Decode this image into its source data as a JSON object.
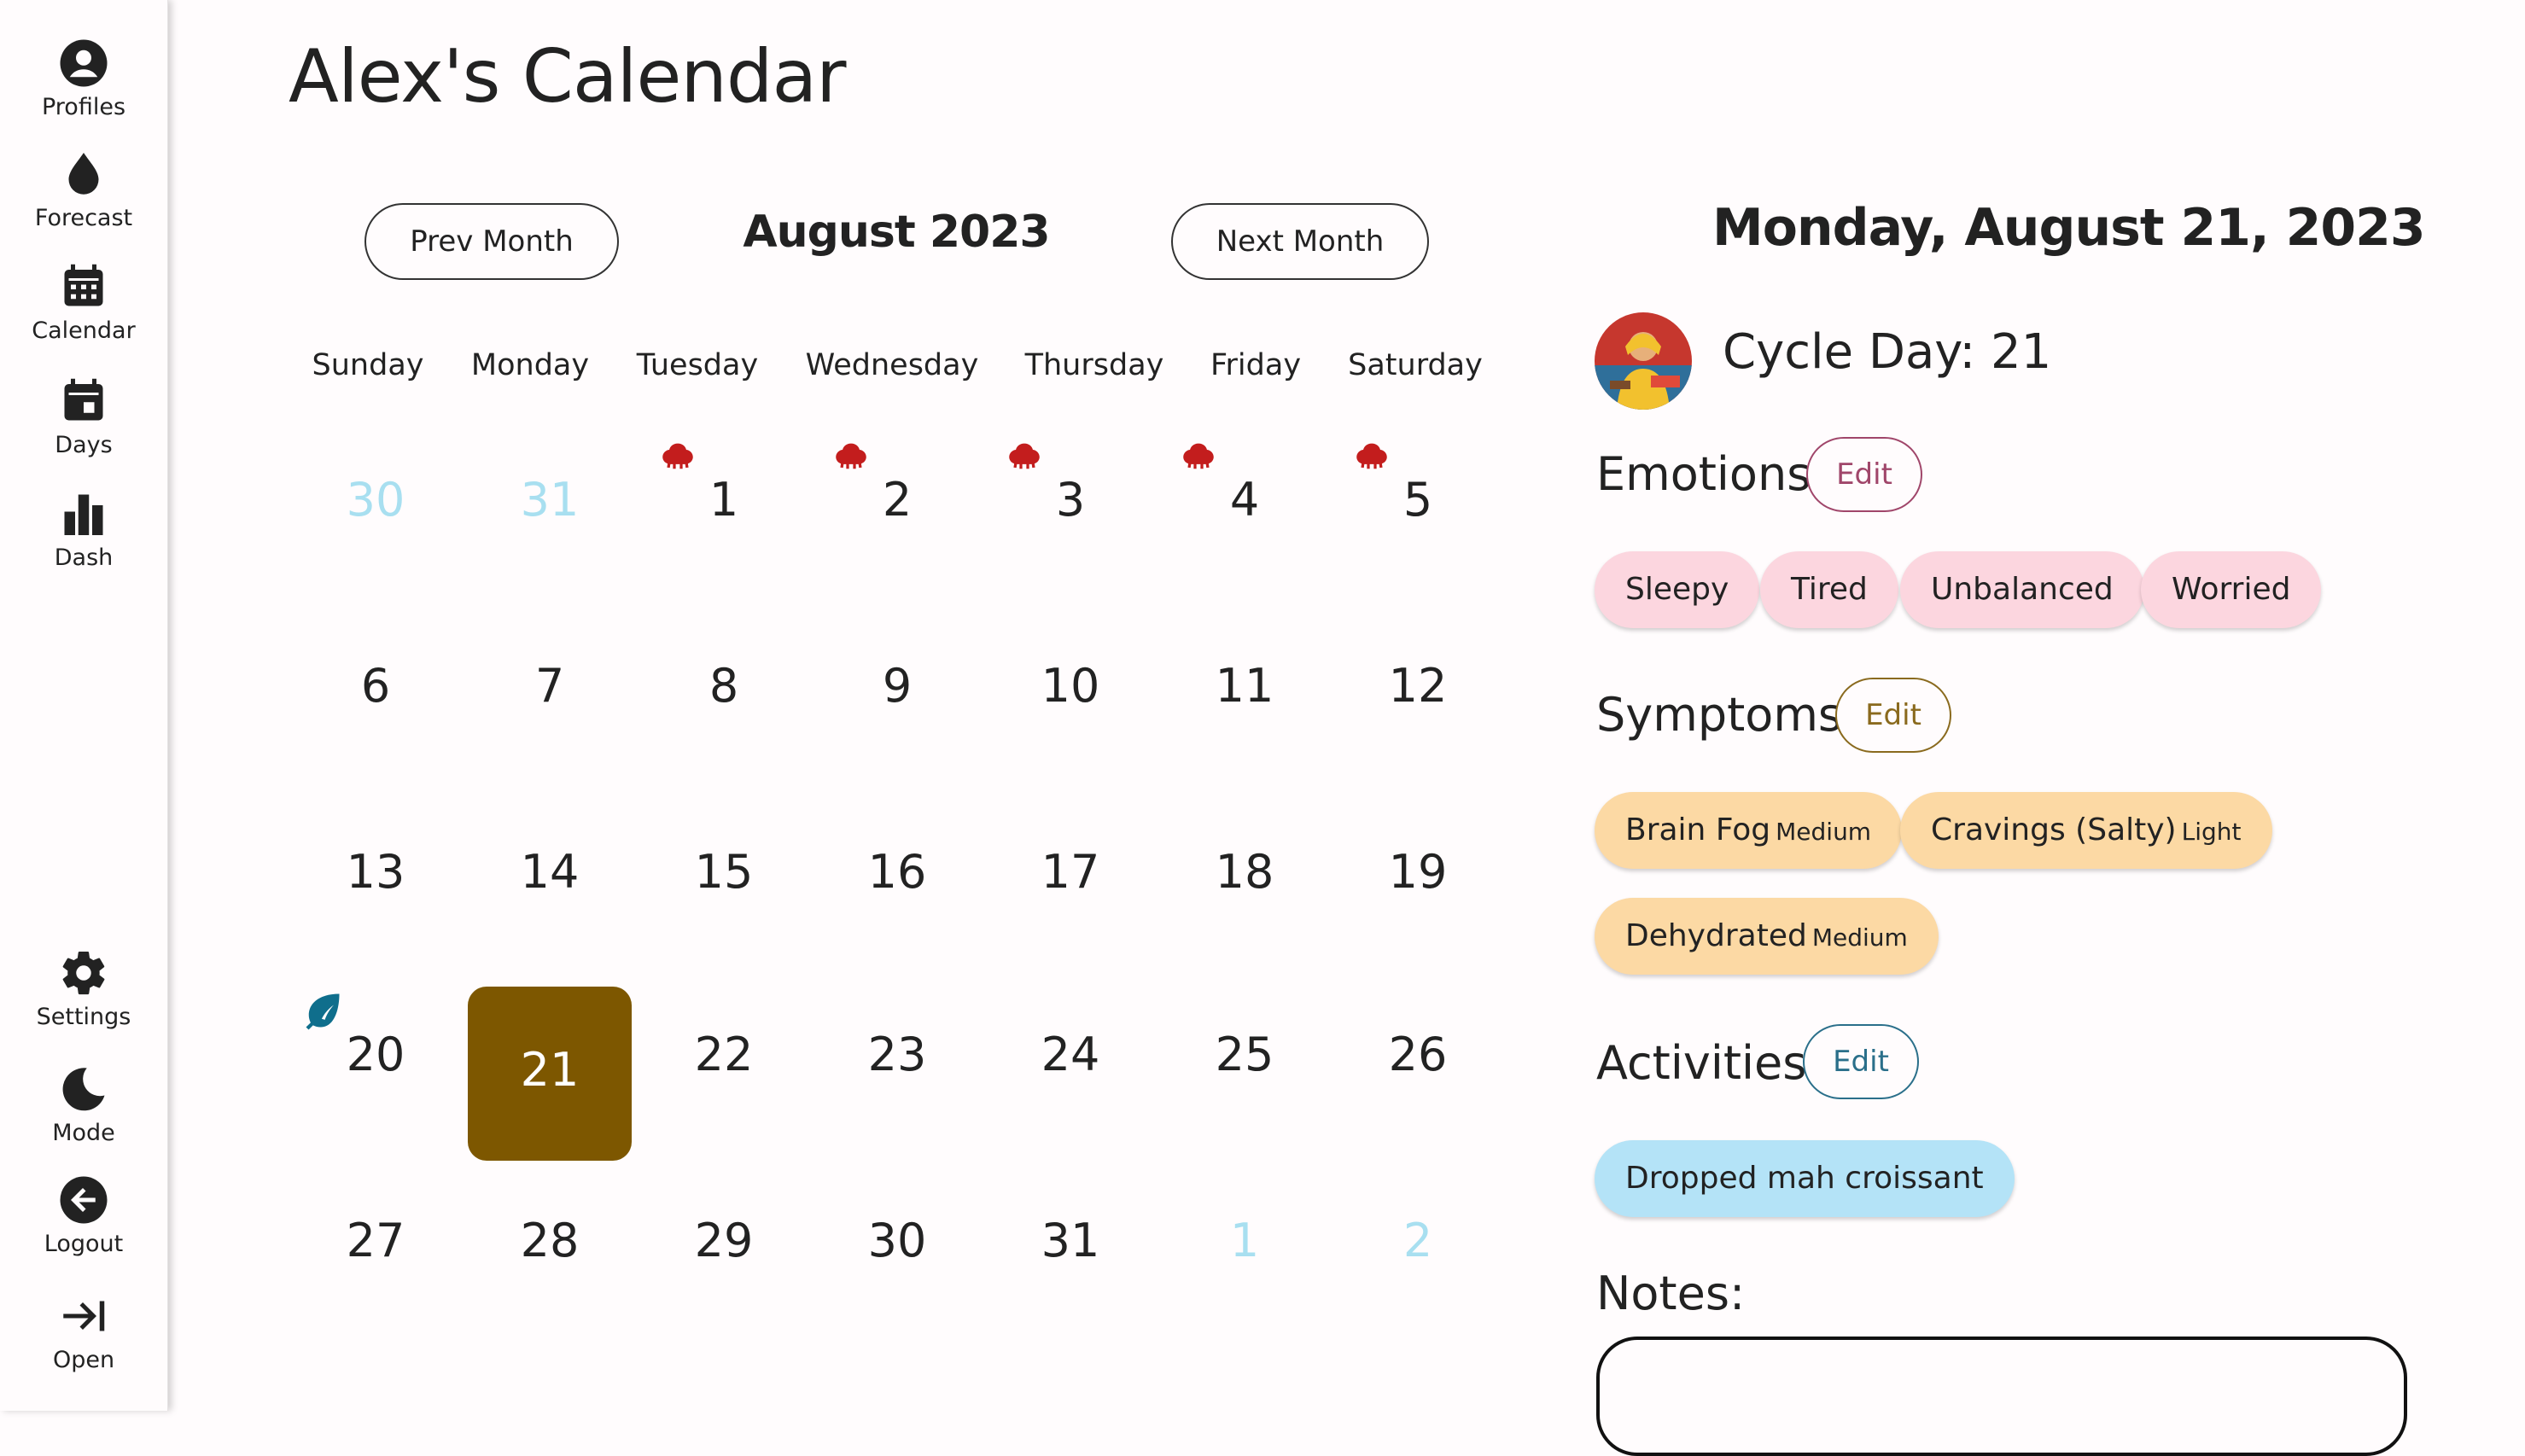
{
  "sidebar": {
    "top_items": [
      {
        "label": "Profiles",
        "icon": "account-circle-icon"
      },
      {
        "label": "Forecast",
        "icon": "drop-icon"
      },
      {
        "label": "Calendar",
        "icon": "calendar-grid-icon"
      },
      {
        "label": "Days",
        "icon": "calendar-day-icon"
      },
      {
        "label": "Dash",
        "icon": "bar-chart-icon"
      }
    ],
    "bottom_items": [
      {
        "label": "Settings",
        "icon": "gear-icon"
      },
      {
        "label": "Mode",
        "icon": "moon-icon"
      },
      {
        "label": "Logout",
        "icon": "logout-arrow-icon"
      },
      {
        "label": "Open",
        "icon": "expand-arrow-icon"
      }
    ]
  },
  "title": "Alex's Calendar",
  "month_nav": {
    "prev_label": "Prev Month",
    "next_label": "Next Month",
    "month_label": "August 2023"
  },
  "weekdays": [
    "Sunday",
    "Monday",
    "Tuesday",
    "Wednesday",
    "Thursday",
    "Friday",
    "Saturday"
  ],
  "weeks": [
    [
      {
        "n": "30",
        "muted": true
      },
      {
        "n": "31",
        "muted": true
      },
      {
        "n": "1",
        "flow": true
      },
      {
        "n": "2",
        "flow": true
      },
      {
        "n": "3",
        "flow": true
      },
      {
        "n": "4",
        "flow": true
      },
      {
        "n": "5",
        "flow": true
      }
    ],
    [
      {
        "n": "6"
      },
      {
        "n": "7"
      },
      {
        "n": "8"
      },
      {
        "n": "9"
      },
      {
        "n": "10"
      },
      {
        "n": "11"
      },
      {
        "n": "12"
      }
    ],
    [
      {
        "n": "13"
      },
      {
        "n": "14"
      },
      {
        "n": "15"
      },
      {
        "n": "16"
      },
      {
        "n": "17"
      },
      {
        "n": "18"
      },
      {
        "n": "19"
      }
    ],
    [
      {
        "n": "20",
        "leaf": true
      },
      {
        "n": "21",
        "selected": true
      },
      {
        "n": "22"
      },
      {
        "n": "23"
      },
      {
        "n": "24"
      },
      {
        "n": "25"
      },
      {
        "n": "26"
      }
    ],
    [
      {
        "n": "27"
      },
      {
        "n": "28"
      },
      {
        "n": "29"
      },
      {
        "n": "30"
      },
      {
        "n": "31"
      },
      {
        "n": "1",
        "muted": true
      },
      {
        "n": "2",
        "muted": true
      }
    ]
  ],
  "details": {
    "date_heading": "Monday, August 21, 2023",
    "cycle_day": "Cycle Day: 21",
    "emotions": {
      "title": "Emotions",
      "edit_label": "Edit",
      "items": [
        "Sleepy",
        "Tired",
        "Unbalanced",
        "Worried"
      ]
    },
    "symptoms": {
      "title": "Symptoms",
      "edit_label": "Edit",
      "items": [
        {
          "name": "Brain Fog",
          "severity": "Medium"
        },
        {
          "name": "Cravings (Salty)",
          "severity": "Light"
        },
        {
          "name": "Dehydrated",
          "severity": "Medium"
        }
      ]
    },
    "activities": {
      "title": "Activities",
      "edit_label": "Edit",
      "items": [
        "Dropped mah croissant"
      ]
    },
    "notes_title": "Notes:",
    "notes_value": ""
  },
  "colors": {
    "selected_day": "#7d5700",
    "muted_day": "#a8dff0",
    "flow_marker": "#c31d1d",
    "leaf_marker": "#0f6e8c",
    "emotion_chip": "#fcd6df",
    "symptom_chip": "#fcd9a4",
    "activity_chip": "#b4e3f7",
    "emotions_edit": "#a0466a",
    "symptoms_edit": "#8a6a1e",
    "activities_edit": "#2a6f8a"
  }
}
